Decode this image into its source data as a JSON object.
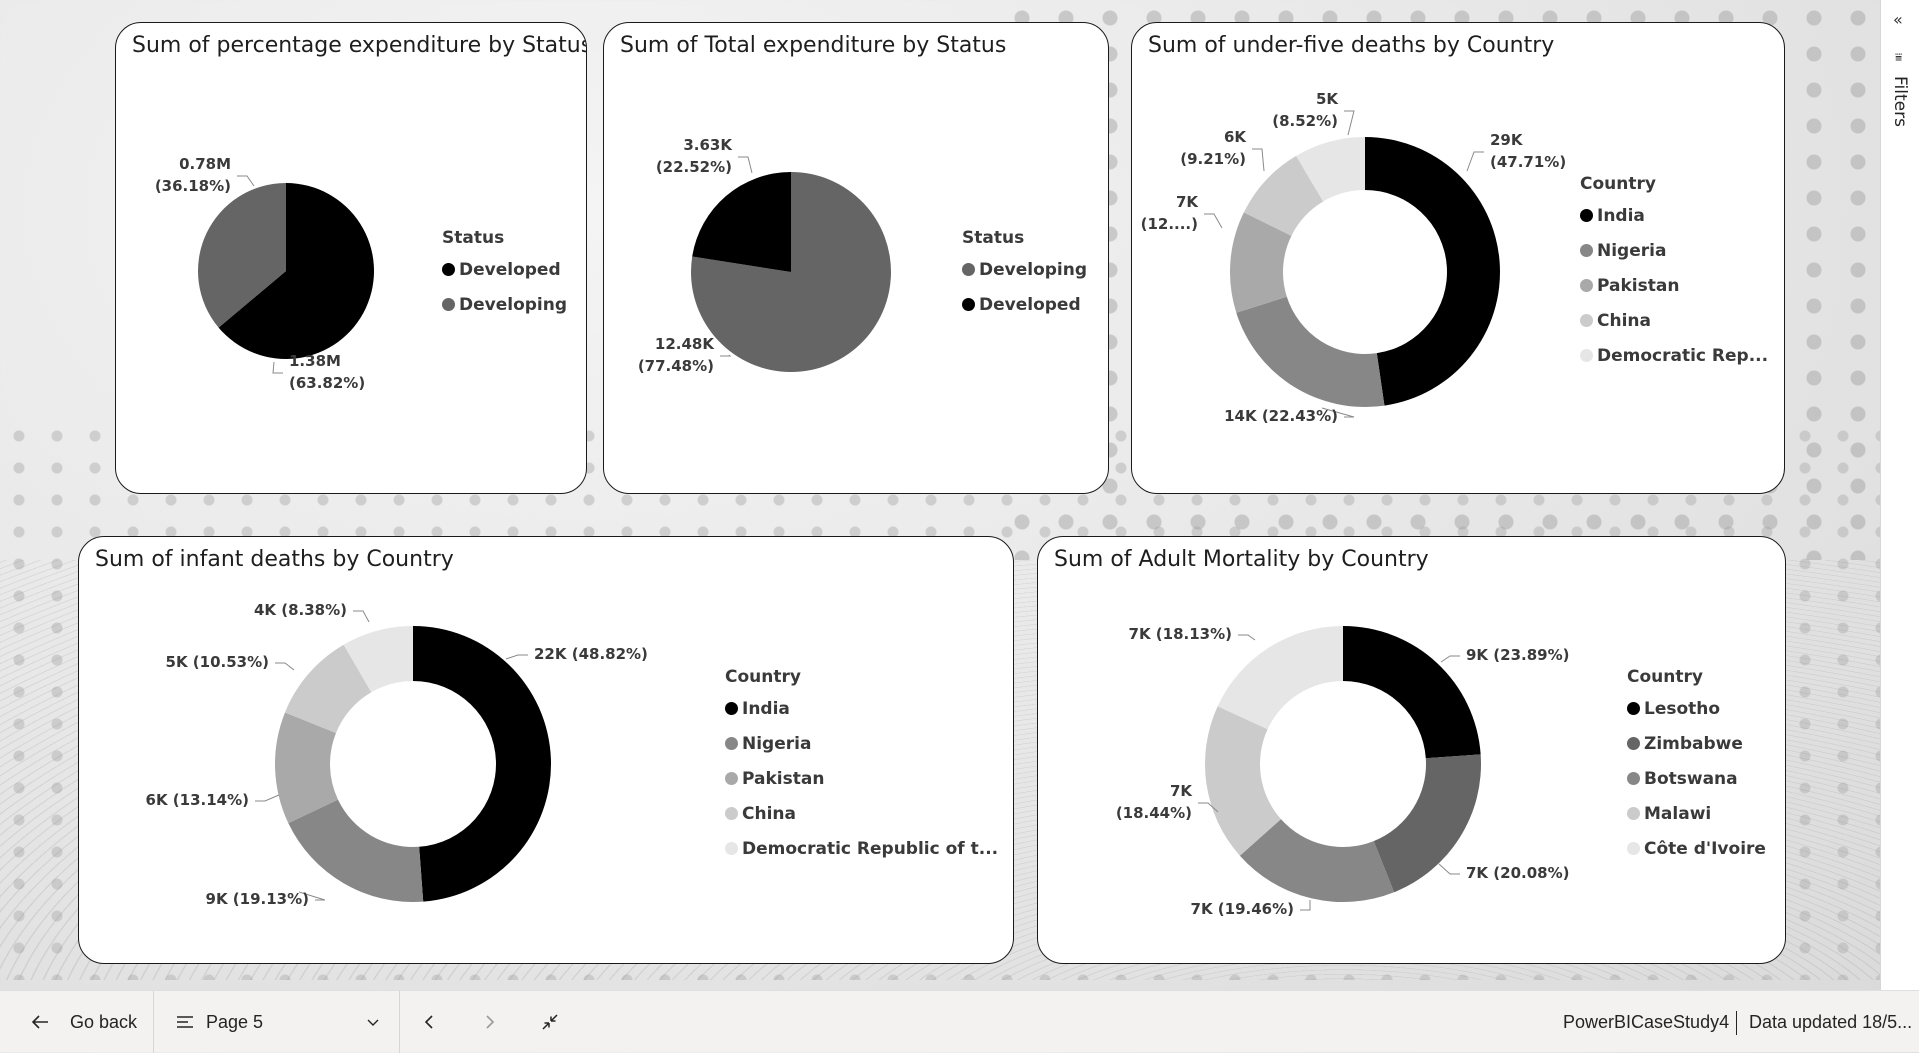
{
  "filters_pane": {
    "label": "Filters",
    "collapse_icon": "double-chevron-left-icon"
  },
  "footer": {
    "go_back": "Go back",
    "page": "Page 5",
    "report_name": "PowerBICaseStudy4",
    "data_updated": "Data updated 18/5..."
  },
  "colors": {
    "black": "#000000",
    "dark_gray": "#656565",
    "mid_gray": "#878787",
    "gray": "#a9a9a9",
    "light_gray": "#cbcbcb",
    "lightest_gray": "#e6e6e6"
  },
  "chart_data": [
    {
      "id": "pct-expenditure",
      "type": "pie",
      "title": "Sum of percentage expenditure by Status",
      "legend_title": "Status",
      "legend_placement": "right",
      "categories": [
        "Developed",
        "Developing"
      ],
      "values": [
        1.38,
        0.78
      ],
      "unit": "M",
      "slice_colors": [
        "#000000",
        "#656565"
      ],
      "labels": [
        [
          "1.38M",
          "(63.82%)"
        ],
        [
          "0.78M",
          "(36.18%)"
        ]
      ]
    },
    {
      "id": "total-expenditure",
      "type": "pie",
      "title": "Sum of Total expenditure by Status",
      "legend_title": "Status",
      "legend_placement": "right",
      "categories": [
        "Developing",
        "Developed"
      ],
      "values": [
        12.48,
        3.63
      ],
      "unit": "K",
      "slice_colors": [
        "#656565",
        "#000000"
      ],
      "labels": [
        [
          "12.48K",
          "(77.48%)"
        ],
        [
          "3.63K",
          "(22.52%)"
        ]
      ]
    },
    {
      "id": "under-five-deaths",
      "type": "donut",
      "title": "Sum of under-five deaths by Country",
      "legend_title": "Country",
      "legend_placement": "right",
      "categories": [
        "India",
        "Nigeria",
        "Pakistan",
        "China",
        "Democratic Rep..."
      ],
      "percentages": [
        47.71,
        22.43,
        12.15,
        9.21,
        8.52
      ],
      "slice_colors": [
        "#000000",
        "#878787",
        "#a9a9a9",
        "#cbcbcb",
        "#e6e6e6"
      ],
      "labels": [
        [
          "29K",
          "(47.71%)"
        ],
        [
          "14K (22.43%)"
        ],
        [
          "7K",
          "(12....)"
        ],
        [
          "6K",
          "(9.21%)"
        ],
        [
          "5K",
          "(8.52%)"
        ]
      ]
    },
    {
      "id": "infant-deaths",
      "type": "donut",
      "title": "Sum of infant deaths by Country",
      "legend_title": "Country",
      "legend_placement": "right",
      "categories": [
        "India",
        "Nigeria",
        "Pakistan",
        "China",
        "Democratic Republic of t..."
      ],
      "percentages": [
        48.82,
        19.13,
        13.14,
        10.53,
        8.38
      ],
      "slice_colors": [
        "#000000",
        "#878787",
        "#a9a9a9",
        "#cbcbcb",
        "#e6e6e6"
      ],
      "labels": [
        [
          "22K (48.82%)"
        ],
        [
          "9K (19.13%)"
        ],
        [
          "6K (13.14%)"
        ],
        [
          "5K (10.53%)"
        ],
        [
          "4K (8.38%)"
        ]
      ]
    },
    {
      "id": "adult-mortality",
      "type": "donut",
      "title": "Sum of Adult Mortality by Country",
      "legend_title": "Country",
      "legend_placement": "right",
      "categories": [
        "Lesotho",
        "Zimbabwe",
        "Botswana",
        "Malawi",
        "Côte d'Ivoire"
      ],
      "percentages": [
        23.89,
        20.08,
        19.46,
        18.44,
        18.13
      ],
      "slice_colors": [
        "#000000",
        "#656565",
        "#878787",
        "#cbcbcb",
        "#e6e6e6"
      ],
      "labels": [
        [
          "9K (23.89%)"
        ],
        [
          "7K (20.08%)"
        ],
        [
          "7K (19.46%)"
        ],
        [
          "7K",
          "(18.44%)"
        ],
        [
          "7K (18.13%)"
        ]
      ]
    }
  ]
}
